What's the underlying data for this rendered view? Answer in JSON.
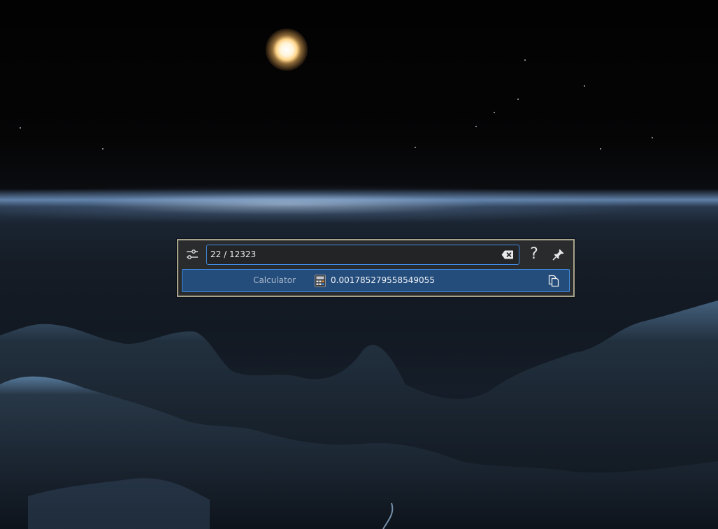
{
  "wallpaper": {
    "sky_color": "#050506",
    "horizon_glow": "#b9d6ff",
    "cloud_color": "#1c2733",
    "sun_color": "#ffe7b0"
  },
  "krunner": {
    "border_color": "#a7a38c",
    "accent": "#3d8be0",
    "search": {
      "value": "22 / 12323",
      "placeholder": ""
    },
    "buttons": {
      "config_icon": "configure-icon",
      "clear_icon": "edit-clear-icon",
      "help_label": "?",
      "pin_icon": "pin-icon"
    },
    "results": [
      {
        "category": "Calculator",
        "icon": "calculator-icon",
        "text": "0.001785279558549055",
        "action_icon": "copy-icon"
      }
    ]
  }
}
